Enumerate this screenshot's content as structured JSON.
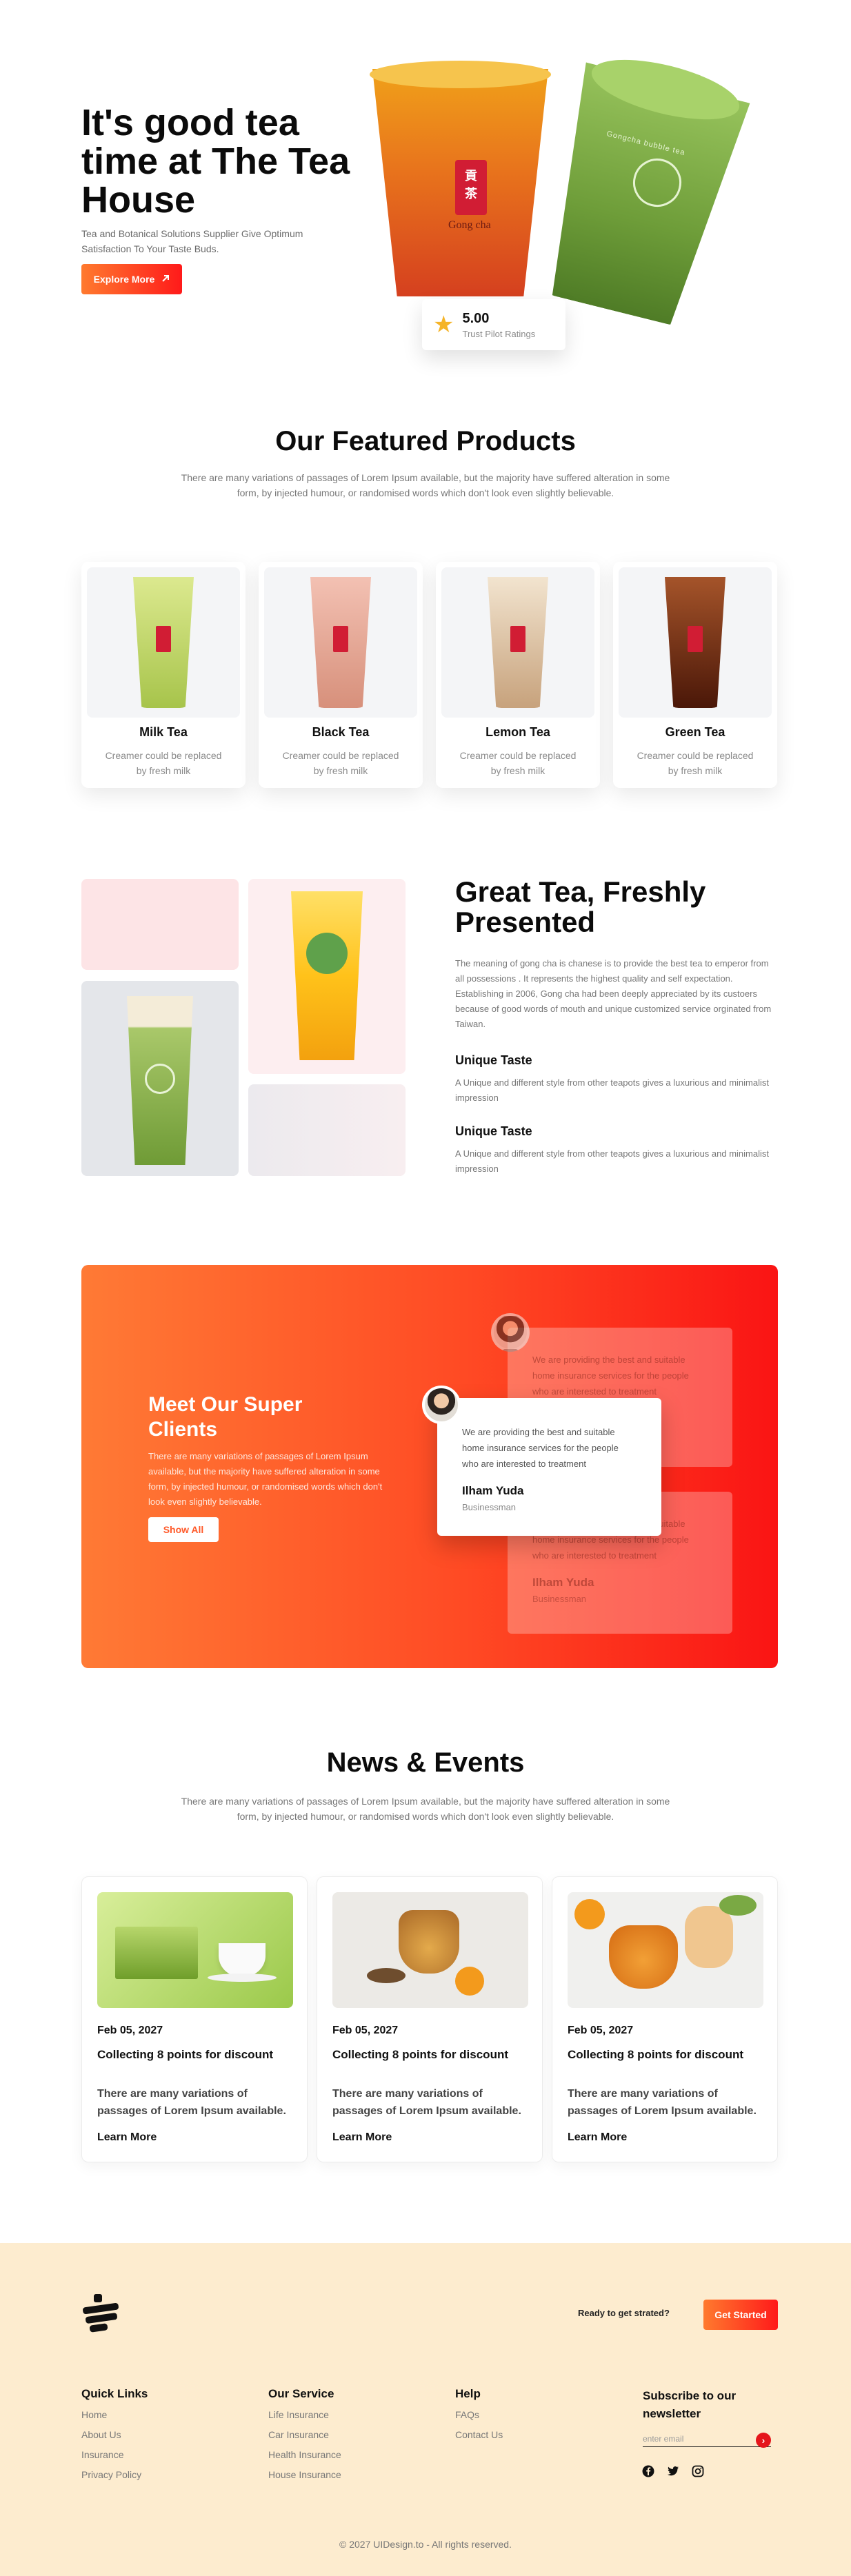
{
  "hero": {
    "title": "It's good tea time at The Tea House",
    "subtitle": "Tea and Botanical Solutions Supplier Give Optimum Satisfaction To Your Taste Buds.",
    "cta_label": "Explore More",
    "cup1_brand_text": "Gong cha",
    "cup2_brand_text": "Gongcha bubble tea",
    "rating": {
      "value": "5.00",
      "label": "Trust Pilot Ratings"
    }
  },
  "featured": {
    "title": "Our Featured Products",
    "description": "There are many variations of passages of Lorem Ipsum available, but the majority have suffered alteration in some form, by injected humour, or randomised words which don't look even slightly believable.",
    "products": [
      {
        "name": "Milk Tea",
        "description": "Creamer could be replaced by fresh milk",
        "color_top": "#dce98f",
        "color_bottom": "#a7c44b"
      },
      {
        "name": "Black Tea",
        "description": "Creamer could be replaced by fresh milk",
        "color_top": "#f3c1b3",
        "color_bottom": "#d7907b"
      },
      {
        "name": "Lemon Tea",
        "description": "Creamer could be replaced by fresh milk",
        "color_top": "#f2e4cf",
        "color_bottom": "#c7a27c"
      },
      {
        "name": "Green Tea",
        "description": "Creamer could be replaced by fresh milk",
        "color_top": "#a5542a",
        "color_bottom": "#4a1708"
      }
    ]
  },
  "great_tea": {
    "title": "Great Tea, Freshly Presented",
    "description": "The meaning of gong cha is chanese is to provide the best tea to emperor from all possessions . It represents the highest quality and self expectation. Establishing in 2006, Gong cha had been deeply appreciated by its custoers because of good words of mouth and unique customized service orginated from Taiwan.",
    "features": [
      {
        "title": "Unique Taste",
        "text": "A Unique and different style from other teapots gives a luxurious and minimalist impression"
      },
      {
        "title": "Unique Taste",
        "text": "A Unique and different style from other teapots gives a luxurious and minimalist impression"
      }
    ]
  },
  "clients": {
    "title": "Meet Our Super Clients",
    "description": "There are many variations of passages of Lorem Ipsum available, but the majority have suffered alteration in some form, by injected humour, or randomised words which don't look even slightly believable.",
    "button_label": "Show All",
    "testimonials": [
      {
        "quote": "We are providing the best and suitable home insurance services for the people who are interested to treatment",
        "name": "",
        "role": ""
      },
      {
        "quote": "We are providing the best and suitable home insurance services for the people who are interested to treatment",
        "name": "Ilham Yuda",
        "role": "Businessman"
      },
      {
        "quote": "We are providing the best and suitable home insurance services for the people who are interested to treatment",
        "name": "Ilham Yuda",
        "role": "Businessman"
      }
    ]
  },
  "news": {
    "title": "News & Events",
    "description": "There are many variations of passages of Lorem Ipsum available, but the majority have suffered alteration in some form, by injected humour, or randomised words which don't look even slightly believable.",
    "items": [
      {
        "date": "Feb 05, 2027",
        "title": "Collecting 8 points for discount",
        "description": "There are many variations of passages of Lorem Ipsum available.",
        "link": "Learn More"
      },
      {
        "date": "Feb 05, 2027",
        "title": "Collecting 8 points for discount",
        "description": "There are many variations of passages of Lorem Ipsum available.",
        "link": "Learn More"
      },
      {
        "date": "Feb 05, 2027",
        "title": "Collecting 8 points for discount",
        "description": "There are many variations of passages of Lorem Ipsum available.",
        "link": "Learn More"
      }
    ]
  },
  "footer": {
    "ready_text": "Ready to get strated?",
    "cta_label": "Get Started",
    "columns": [
      {
        "title": "Quick Links",
        "links": [
          "Home",
          "About Us",
          "Insurance",
          "Privacy Policy"
        ]
      },
      {
        "title": "Our Service",
        "links": [
          "Life Insurance",
          "Car Insurance",
          "Health Insurance",
          "House Insurance"
        ]
      },
      {
        "title": "Help",
        "links": [
          "FAQs",
          "Contact Us"
        ]
      }
    ],
    "subscribe_title": "Subscribe to our newsletter",
    "email_placeholder": "enter email",
    "social_icons": [
      "facebook-icon",
      "twitter-icon",
      "instagram-icon"
    ],
    "copyright": "© 2027 UIDesign.to - All rights reserved."
  },
  "colors": {
    "accent_start": "#ff7a2e",
    "accent_end": "#ff1a1a",
    "footer_bg": "#fdeccf",
    "star": "#f5b428"
  }
}
